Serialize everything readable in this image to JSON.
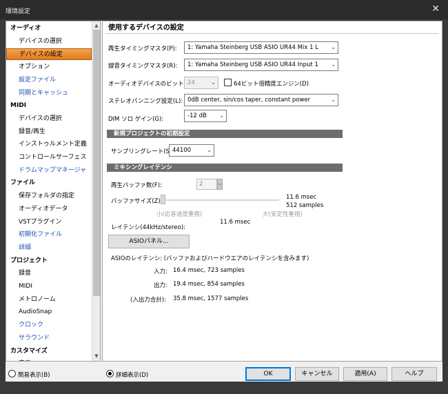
{
  "window": {
    "title": "環境設定",
    "close_glyph": "✕"
  },
  "sidebar": {
    "items": [
      {
        "label": "オーディオ",
        "type": "cat"
      },
      {
        "label": "デバイスの選択",
        "type": "sub"
      },
      {
        "label": "デバイスの設定",
        "type": "sub",
        "selected": true
      },
      {
        "label": "オプション",
        "type": "sub"
      },
      {
        "label": "設定ファイル",
        "type": "sub",
        "link": true
      },
      {
        "label": "同期とキャッシュ",
        "type": "sub",
        "link": true
      },
      {
        "label": "MIDI",
        "type": "cat"
      },
      {
        "label": "デバイスの選択",
        "type": "sub"
      },
      {
        "label": "録音/再生",
        "type": "sub"
      },
      {
        "label": "インストゥルメント定義",
        "type": "sub"
      },
      {
        "label": "コントロールサーフェス",
        "type": "sub"
      },
      {
        "label": "ドラムマップマネージャ",
        "type": "sub",
        "link": true
      },
      {
        "label": "ファイル",
        "type": "cat"
      },
      {
        "label": "保存フォルダの指定",
        "type": "sub"
      },
      {
        "label": "オーディオデータ",
        "type": "sub"
      },
      {
        "label": "VSTプラグイン",
        "type": "sub"
      },
      {
        "label": "初期化ファイル",
        "type": "sub",
        "link": true
      },
      {
        "label": "詳細",
        "type": "sub",
        "link": true
      },
      {
        "label": "プロジェクト",
        "type": "cat"
      },
      {
        "label": "録音",
        "type": "sub"
      },
      {
        "label": "MIDI",
        "type": "sub"
      },
      {
        "label": "メトロノーム",
        "type": "sub"
      },
      {
        "label": "AudioSnap",
        "type": "sub"
      },
      {
        "label": "クロック",
        "type": "sub",
        "link": true
      },
      {
        "label": "サラウンド",
        "type": "sub",
        "link": true
      },
      {
        "label": "カスタマイズ",
        "type": "cat"
      },
      {
        "label": "表示",
        "type": "sub"
      }
    ]
  },
  "panel": {
    "title": "使用するデバイスの設定",
    "playback_master_label": "再生タイミングマスタ(P):",
    "playback_master_value": "1: Yamaha Steinberg USB ASIO UR44 Mix 1 L",
    "record_master_label": "録音タイミングマスタ(R):",
    "record_master_value": "1: Yamaha Steinberg USB ASIO UR44 Input 1",
    "bit_depth_label": "オーディオデバイスのビット数(T):",
    "bit_depth_value": "24",
    "engine64_label": "64ビット倍精度エンジン(D)",
    "panning_label": "ステレオパンニング設定(L):",
    "panning_value": "0dB center, sin/cos taper, constant power",
    "dim_label": "DIM ソロ ゲイン(G):",
    "dim_value": "-12 dB",
    "section_project": "新規プロジェクトの初期設定",
    "sampling_label": "サンプリングレート(S):",
    "sampling_value": "44100",
    "section_latency": "ミキシングレイテンシ",
    "buffers_label": "再生バッファ数(F):",
    "buffers_value": "2",
    "buffer_size_label": "バッファサイズ(Z):",
    "buffer_msec": "11.6 msec",
    "buffer_samples": "512 samples",
    "slider_min_label": "小(応答速度重視)",
    "slider_max_label": "大(安定性重視)",
    "slider_position": 0.0,
    "latency_label": "レイテンシ(44kHz/stereo):",
    "latency_value": "11.6 msec",
    "asio_button": "ASIOパネル...",
    "asio_latency_title": "ASIOのレイテンシ: (バッファおよびハードウエアのレイテンシを含みます)",
    "input_label": "入力:",
    "input_value": "16.4 msec, 723 samples",
    "output_label": "出力:",
    "output_value": "19.4 msec, 854 samples",
    "total_label": "(入出力合計):",
    "total_value": "35.8 msec, 1577 samples"
  },
  "bottom": {
    "simple_label": "簡易表示(B)",
    "detail_label": "詳細表示(D)",
    "ok": "OK",
    "cancel": "キャンセル",
    "apply": "適用(A)",
    "help": "ヘルプ"
  }
}
